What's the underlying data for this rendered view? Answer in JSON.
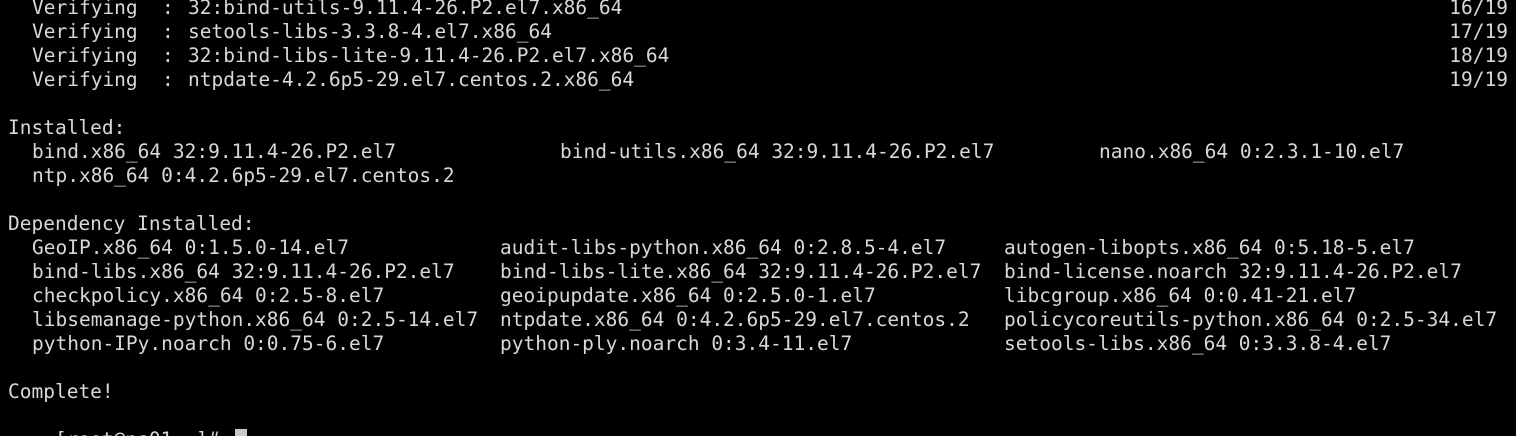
{
  "terminal": {
    "verify": [
      {
        "action": "Verifying",
        "package": "32:bind-utils-9.11.4-26.P2.el7.x86_64",
        "progress": "16/19"
      },
      {
        "action": "Verifying",
        "package": "setools-libs-3.3.8-4.el7.x86_64",
        "progress": "17/19"
      },
      {
        "action": "Verifying",
        "package": "32:bind-libs-lite-9.11.4-26.P2.el7.x86_64",
        "progress": "18/19"
      },
      {
        "action": "Verifying",
        "package": "ntpdate-4.2.6p5-29.el7.centos.2.x86_64",
        "progress": "19/19"
      }
    ],
    "installed_heading": "Installed:",
    "installed_rows": [
      [
        "bind.x86_64 32:9.11.4-26.P2.el7",
        "bind-utils.x86_64 32:9.11.4-26.P2.el7",
        "nano.x86_64 0:2.3.1-10.el7"
      ],
      [
        "ntp.x86_64 0:4.2.6p5-29.el7.centos.2",
        "",
        ""
      ]
    ],
    "dependency_heading": "Dependency Installed:",
    "dependency_rows": [
      [
        "GeoIP.x86_64 0:1.5.0-14.el7",
        "audit-libs-python.x86_64 0:2.8.5-4.el7",
        "autogen-libopts.x86_64 0:5.18-5.el7"
      ],
      [
        "bind-libs.x86_64 32:9.11.4-26.P2.el7",
        "bind-libs-lite.x86_64 32:9.11.4-26.P2.el7",
        "bind-license.noarch 32:9.11.4-26.P2.el7"
      ],
      [
        "checkpolicy.x86_64 0:2.5-8.el7",
        "geoipupdate.x86_64 0:2.5.0-1.el7",
        "libcgroup.x86_64 0:0.41-21.el7"
      ],
      [
        "libsemanage-python.x86_64 0:2.5-14.el7",
        "ntpdate.x86_64 0:4.2.6p5-29.el7.centos.2",
        "policycoreutils-python.x86_64 0:2.5-34.el7"
      ],
      [
        "python-IPy.noarch 0:0.75-6.el7",
        "python-ply.noarch 0:3.4-11.el7",
        "setools-libs.x86_64 0:3.3.8-4.el7"
      ]
    ],
    "complete": "Complete!",
    "prompt": "[root@ns01 ~]# "
  }
}
